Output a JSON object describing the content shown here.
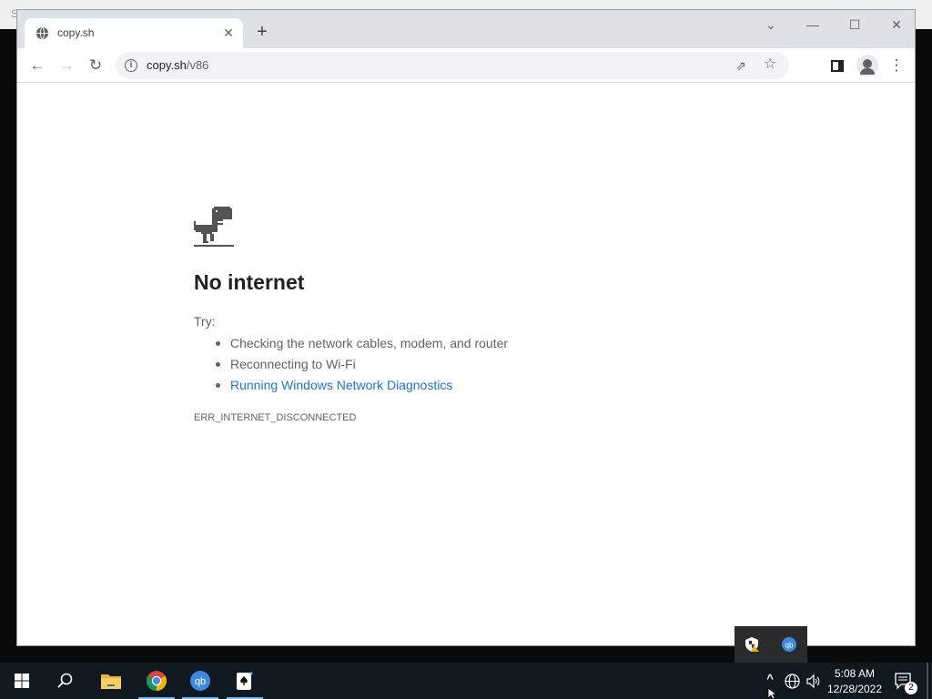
{
  "desktop": {
    "corner_text": "S"
  },
  "browser": {
    "tab": {
      "title": "copy.sh",
      "close_glyph": "✕"
    },
    "newtab_glyph": "+",
    "window_controls": {
      "dropdown": "⌄",
      "minimize": "—",
      "maximize": "☐",
      "close": "✕"
    },
    "toolbar": {
      "back": "←",
      "forward": "→",
      "reload": "↻",
      "url_host": "copy.sh",
      "url_path": "/v86",
      "share_glyph": "⇗",
      "star_glyph": "☆",
      "menu_glyph": "⋮"
    }
  },
  "error_page": {
    "heading": "No internet",
    "try_label": "Try:",
    "suggestions": [
      "Checking the network cables, modem, and router",
      "Reconnecting to Wi-Fi",
      "Running Windows Network Diagnostics"
    ],
    "error_code": "ERR_INTERNET_DISCONNECTED"
  },
  "tray_popup": {
    "icons": [
      "security-warning-icon",
      "qbittorrent-icon"
    ]
  },
  "taskbar": {
    "apps": [
      "start-icon",
      "search-icon",
      "file-explorer-icon",
      "chrome-icon",
      "qbittorrent-icon",
      "solitaire-icon"
    ],
    "tray": {
      "chevron": "^",
      "network_glyph": "⊕",
      "volume_glyph": "🔊"
    },
    "clock": {
      "time": "5:08 AM",
      "date": "12/28/2022"
    },
    "notifications_count": "2"
  },
  "colors": {
    "link": "#1a73e8",
    "taskbar": "#101820",
    "tabstrip": "#dee1e6"
  }
}
